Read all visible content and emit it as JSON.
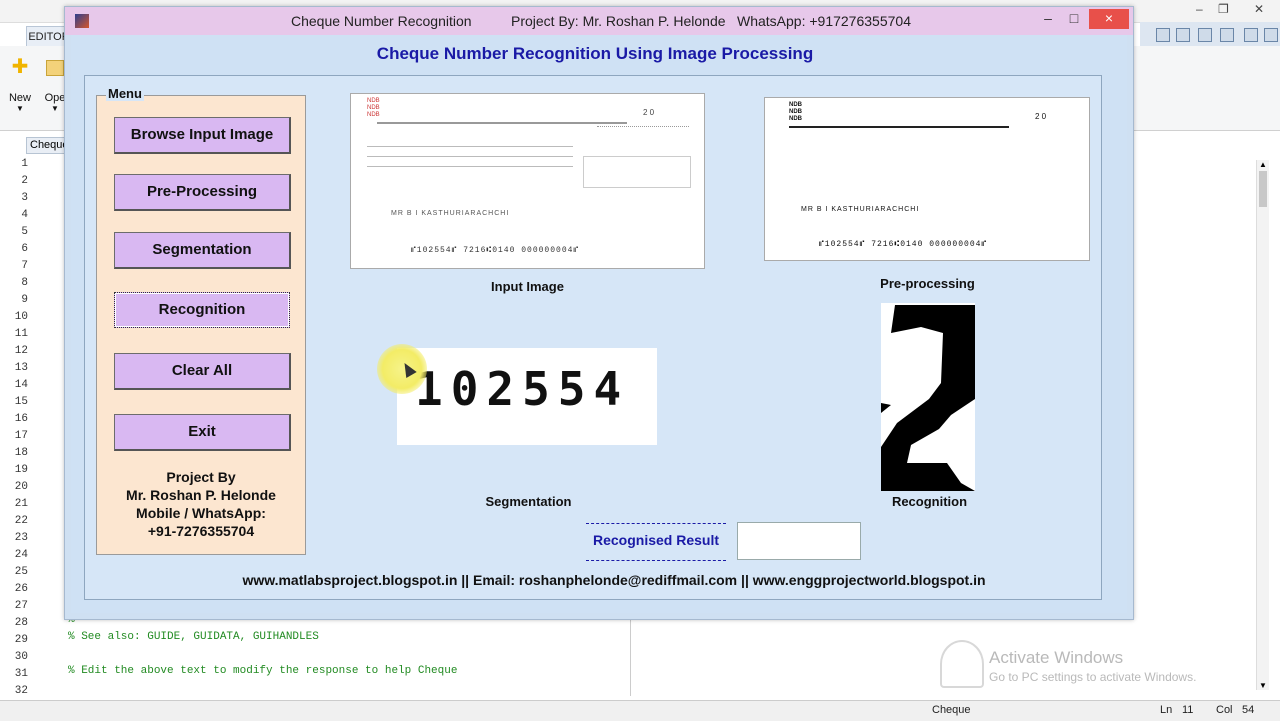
{
  "window": {
    "title": "Cheque Number Recognition",
    "project_by": "Project By: Mr. Roshan P. Helonde",
    "whatsapp": "WhatsApp: +917276355704",
    "min": "–",
    "max": "□",
    "close": "×"
  },
  "editor": {
    "tab": "EDITOR",
    "new_label": "New",
    "open_label": "Ope",
    "file_tab": "Cheque",
    "line_numbers": [
      "1",
      "2",
      "3",
      "4",
      "5",
      "6",
      "7",
      "8",
      "9",
      "10",
      "11",
      "12",
      "13",
      "14",
      "15",
      "16",
      "17",
      "18",
      "19",
      "20",
      "21",
      "22",
      "23",
      "24",
      "25",
      "26",
      "27",
      "28",
      "29",
      "30",
      "31",
      "32"
    ],
    "code_line_28": "%",
    "code_line_29": "% See also: GUIDE, GUIDATA, GUIHANDLES",
    "code_line_31": "% Edit the above text to modify the response to help Cheque"
  },
  "gui": {
    "main_title": "Cheque Number Recognition Using Image Processing",
    "menu_label": "Menu",
    "buttons": {
      "browse": "Browse Input Image",
      "preprocess": "Pre-Processing",
      "segmentation": "Segmentation",
      "recognition": "Recognition",
      "clear": "Clear All",
      "exit": "Exit"
    },
    "project_by_lines": [
      "Project By",
      "Mr. Roshan P. Helonde",
      "Mobile / WhatsApp:",
      "+91-7276355704"
    ],
    "labels": {
      "input_image": "Input Image",
      "preprocessing": "Pre-processing",
      "segmentation": "Segmentation",
      "recognition": "Recognition",
      "recognised_result": "Recognised Result"
    },
    "segmented_digits": "102554",
    "recognised_result_value": "",
    "footer": "www.matlabsproject.blogspot.in  ||  Email: roshanphelonde@rediffmail.com  ||  www.enggprojectworld.blogspot.in"
  },
  "cheque": {
    "bank_lines": [
      "NDB",
      "NDB",
      "NDB"
    ],
    "date": "2 0",
    "payee_name": "MR B I KASTHURIARACHCHI",
    "micr_line": "⑈102554⑈ 7216⑆0140 000000004⑈"
  },
  "status": {
    "file": "Cheque",
    "ln_label": "Ln",
    "ln_value": "11",
    "col_label": "Col",
    "col_value": "54"
  },
  "activate": {
    "line1": "Activate Windows",
    "line2": "Go to PC settings to activate Windows."
  },
  "colors": {
    "title_blue": "#1a1aa6",
    "button_purple": "#d9b8f2",
    "menu_bg": "#fce6d0",
    "panel_bg": "#d6e6f7",
    "titlebar": "#e7c8ea"
  }
}
